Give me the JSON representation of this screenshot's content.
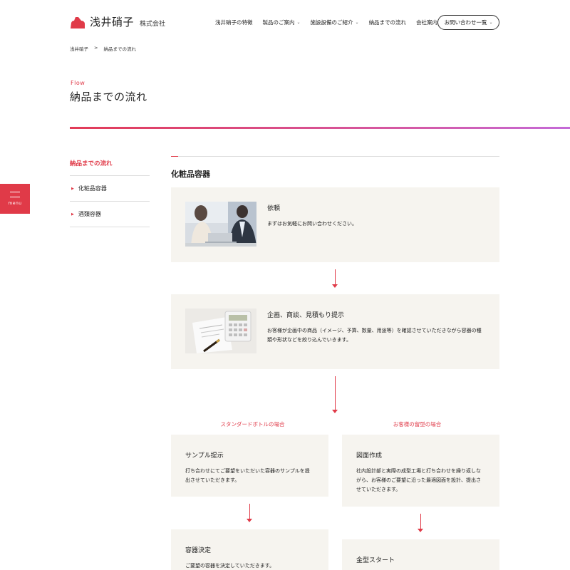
{
  "header": {
    "logo_name": "浅井硝子",
    "logo_suffix": "株式会社",
    "nav": [
      {
        "label": "浅井硝子の特徴",
        "dropdown": false
      },
      {
        "label": "製品のご案内",
        "dropdown": true
      },
      {
        "label": "施設設備のご紹介",
        "dropdown": true
      },
      {
        "label": "納品までの流れ",
        "dropdown": false
      },
      {
        "label": "会社案内",
        "dropdown": false
      }
    ],
    "contact_label": "お問い合わせ一覧",
    "contact_dropdown": true
  },
  "breadcrumb": {
    "home": "浅井硝子",
    "separator": ">",
    "current": "納品までの流れ"
  },
  "page": {
    "eyebrow": "Flow",
    "title": "納品までの流れ"
  },
  "menu_tab": {
    "label": "menu"
  },
  "sidebar": {
    "heading": "納品までの流れ",
    "items": [
      {
        "label": "化粧品容器"
      },
      {
        "label": "酒類容器"
      }
    ]
  },
  "main": {
    "section_title": "化粧品容器",
    "steps": [
      {
        "title": "依頼",
        "text": "まずはお気軽にお問い合わせください。",
        "image": "business-meeting-photo"
      },
      {
        "title": "企画、商談、見積もり提示",
        "text": "お客様が企画中の商品（イメージ、予算、数量、用途等）を確認させていただきながら容器の種類や形状などを絞り込んでいきます。",
        "image": "calculator-document-photo"
      }
    ],
    "branches": [
      {
        "label": "スタンダードボトルの場合",
        "steps": [
          {
            "title": "サンプル提示",
            "text": "打ち合わせにてご要望をいただいた容器のサンプルを提出させていただきます。"
          },
          {
            "title": "容器決定",
            "text": "ご要望の容器を決定していただきます。"
          }
        ]
      },
      {
        "label": "お客様の留型の場合",
        "steps": [
          {
            "title": "図面作成",
            "text": "社内設計部と実際の成型工場と打ち合わせを繰り返しながら、お客様のご要望に沿った最適図面を設計、提出させていただきます。"
          },
          {
            "title": "金型スタート",
            "text": ""
          }
        ]
      }
    ]
  },
  "colors": {
    "accent": "#e03a48",
    "card_bg": "#f6f4ef",
    "gradient_start": "#e23b57",
    "gradient_end": "#c46ad8"
  }
}
